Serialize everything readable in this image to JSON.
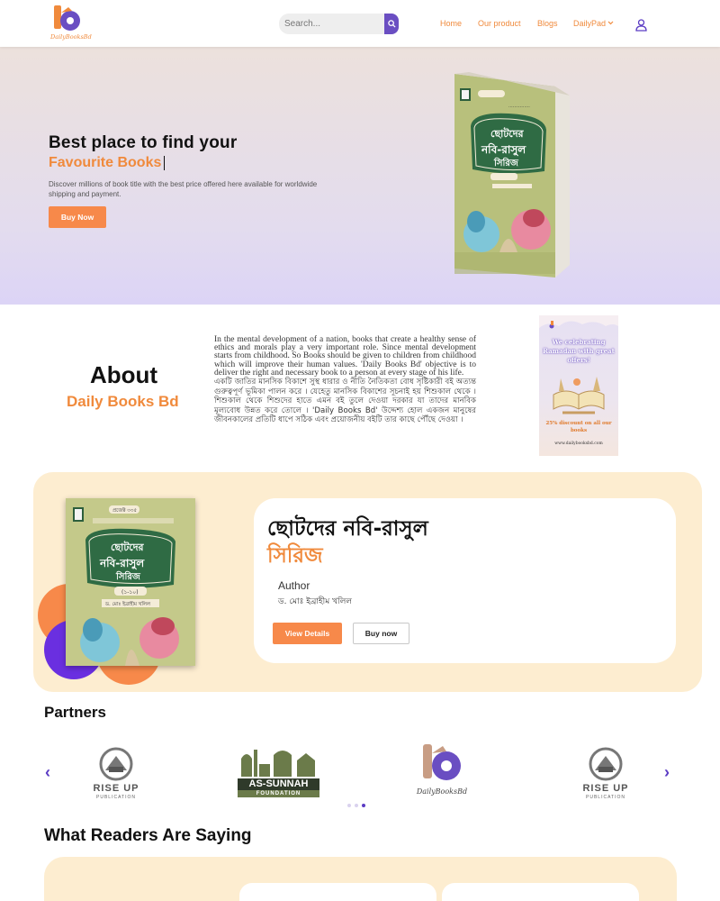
{
  "nav": {
    "logo_text": "DailyBooksBd",
    "search_placeholder": "Search...",
    "links": [
      "Home",
      "Our product",
      "Blogs",
      "DailyPad"
    ],
    "colors": {
      "accent": "#f08a3c",
      "purple": "#6a4ec2"
    }
  },
  "hero": {
    "title": "Best place to find your",
    "highlight": "Favourite Books",
    "description": "Discover millions of book title with the best price offered here available for worldwide shipping and payment.",
    "button": "Buy Now"
  },
  "about": {
    "title": "About",
    "subtitle": "Daily Books Bd",
    "text_en": "In the mental development of a nation, books that create a healthy sense of ethics and morals play a very important role. Since mental development starts from childhood. So Books should be given to children from childhood which will improve their human values. 'Daily Books Bd' objective is to deliver the right and necessary book to a person at every stage of his life.",
    "text_bn": "একটি জাতির মানসিক বিকাশে সুস্থ ধারার ও নীতি নৈতিকতা বোধ সৃষ্টিকারী বই অত্যন্ত গুরুত্বপূর্ণ ভূমিকা পালন করে । যেহেতু মানসিক বিকাশের সূচনাই হয় শিশুকাল থেকে । শিশুকাল থেকে শিশুদের হাতে এমন বই তুলে দেওয়া দরকার যা তাদের মানবিক মূল্যবোধ উন্নত করে তোলে । 'Daily Books Bd' উদ্দেশ্য হোল একজন মানুষের জীবনকালের প্রতিটি ধাপে সঠিক এবং প্রয়োজনীয় বইটি তার কাছে পৌঁছে দেওয়া ।",
    "ad": {
      "headline": "We celebrating Ramadan with great offers!",
      "discount": "25% discount on all our books",
      "url": "www.dailybooksbd.com"
    }
  },
  "featured": {
    "title_line1": "ছোটদের নবি-রাসুল",
    "title_line2": "সিরিজ",
    "author_label": "Author",
    "author": "ড. মোঃ ইব্রাহীম খলিল",
    "view_button": "View Details",
    "buy_button": "Buy now",
    "book_cover": {
      "series": "প্রজেক্ট ৩৩৫",
      "title1": "ছোটদের",
      "title2": "নবি-রাসুল",
      "title3": "সিরিজ",
      "volume": "(১-১০)",
      "author": "ড. মোঃ ইব্রাহীম খলিল"
    }
  },
  "partners": {
    "heading": "Partners",
    "items": [
      {
        "name": "RISE UP",
        "sub": "PUBLICATION"
      },
      {
        "name": "AS-SUNNAH",
        "sub": "FOUNDATION"
      },
      {
        "name": "DailyBooksBd",
        "sub": ""
      },
      {
        "name": "RISE UP",
        "sub": "PUBLICATION"
      }
    ],
    "active_dot": 2
  },
  "readers": {
    "heading": "What Readers Are Saying"
  }
}
